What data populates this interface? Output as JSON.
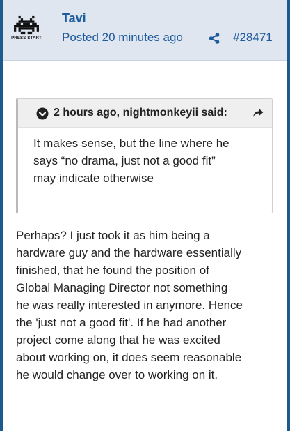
{
  "post": {
    "author": "Tavi",
    "avatar_caption": "PRESS START",
    "posted": "Posted 20 minutes ago",
    "post_number": "#28471",
    "quote": {
      "citation": "2 hours ago, nightmonkeyii said:",
      "lines": [
        "It makes sense, but the line where he",
        "says “no drama, just not a good fit”",
        "may indicate otherwise"
      ]
    },
    "body_lines": [
      "Perhaps? I just took it as him being a",
      "hardware guy and the hardware essentially",
      "finished, that he found the position of",
      "Global Managing Director not something",
      "he was really interested in anymore. Hence",
      "the 'just not a good fit'. If he had another",
      "project come along that he was excited",
      "about working on, it does seem reasonable",
      "he would change over to working on it."
    ]
  },
  "icons": {
    "avatar": "space-invader-icon",
    "share": "share-icon",
    "quote_toggle": "chevron-down-circle-icon",
    "go_to_quote": "arrow-right-icon"
  },
  "colors": {
    "accent": "#1d5a9e",
    "header_bg": "#dfe6ef",
    "post_border": "#1d5a8e"
  }
}
